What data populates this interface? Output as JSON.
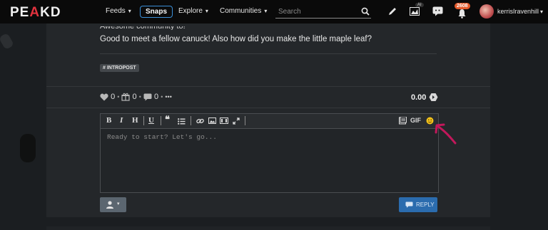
{
  "header": {
    "logo": {
      "prefix": "PE",
      "highlight": "A",
      "suffix": "KD"
    },
    "nav": [
      {
        "label": "Feeds"
      },
      {
        "label": "Snaps"
      },
      {
        "label": "Explore"
      },
      {
        "label": "Communities"
      }
    ],
    "search": {
      "placeholder": "Search"
    },
    "ai_badge": "AI",
    "notification_count": "2608",
    "username": "kerrisIravenhill"
  },
  "post": {
    "faded_text": "Awesome community to!",
    "comment_text": "Good to meet a fellow canuck! Also how did you make the little maple leaf?",
    "tag": "# INTROPOST",
    "likes": "0",
    "gifts": "0",
    "comments": "0",
    "more": "•••",
    "separator": "•",
    "payout": "0.00"
  },
  "editor": {
    "toolbar": {
      "bold": "B",
      "italic": "I",
      "heading": "H",
      "underline": "U",
      "gif": "GIF"
    },
    "placeholder": "Ready to start? Let's go...",
    "reply_label": "REPLY"
  },
  "colors": {
    "accent": "#e2323e",
    "snaps_border": "#3b8fd8",
    "reply_bg": "#2b6cae",
    "badge": "#e55a2b",
    "annotation_arrow": "#c2185b"
  }
}
